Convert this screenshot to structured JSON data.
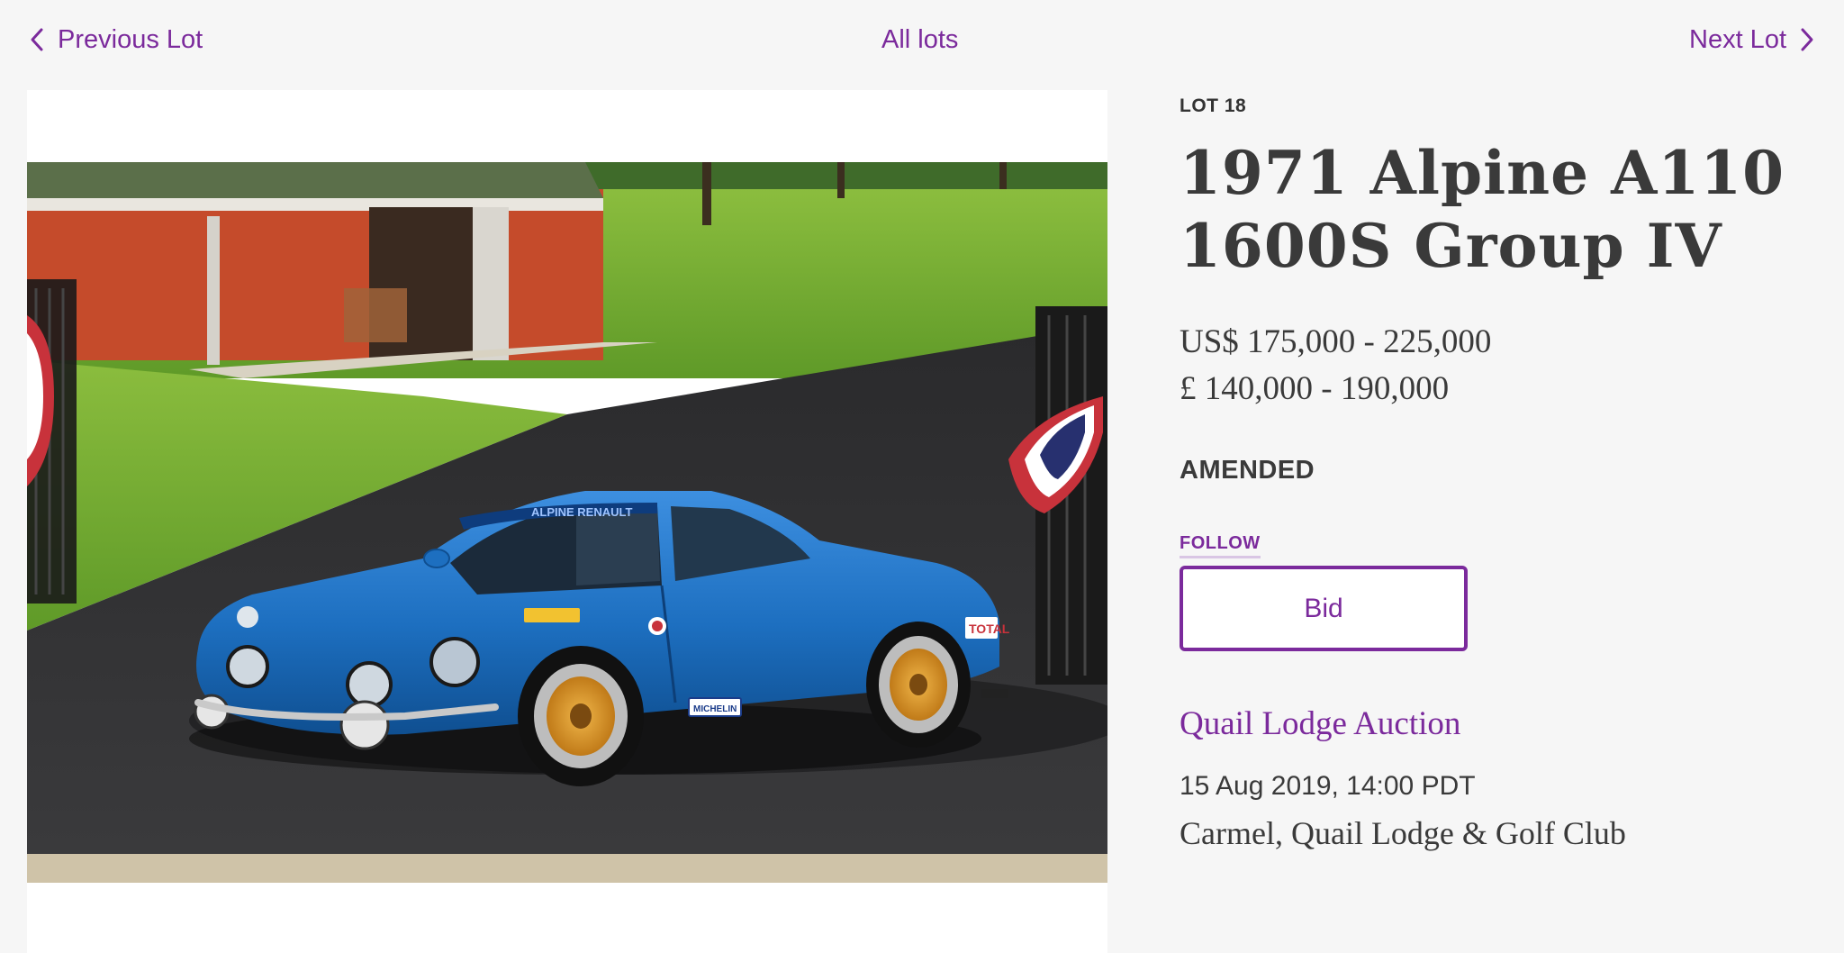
{
  "nav": {
    "previous_label": "Previous Lot",
    "all_label": "All lots",
    "next_label": "Next Lot",
    "prev_icon": "chevron-left-icon",
    "next_icon": "chevron-right-icon"
  },
  "lot": {
    "number": "LOT 18",
    "title_line1": "1971 Alpine A110",
    "title_line2": "1600S Group IV",
    "estimate_usd": "US$ 175,000 - 225,000",
    "estimate_gbp": "£ 140,000 - 190,000",
    "status": "AMENDED",
    "follow_label": "FOLLOW",
    "bid_label": "Bid"
  },
  "auction": {
    "name": "Quail Lodge Auction",
    "date": "15 Aug 2019, 14:00 PDT",
    "venue": "Carmel, Quail Lodge & Golf Club"
  },
  "photo": {
    "car_labels": [
      "ALPINE RENAULT",
      "TOTAL",
      "MICHELIN"
    ]
  },
  "colors": {
    "accent": "#7b2a9c",
    "text": "#333333",
    "background": "#f6f6f6",
    "car_blue": "#1d6fc0"
  }
}
